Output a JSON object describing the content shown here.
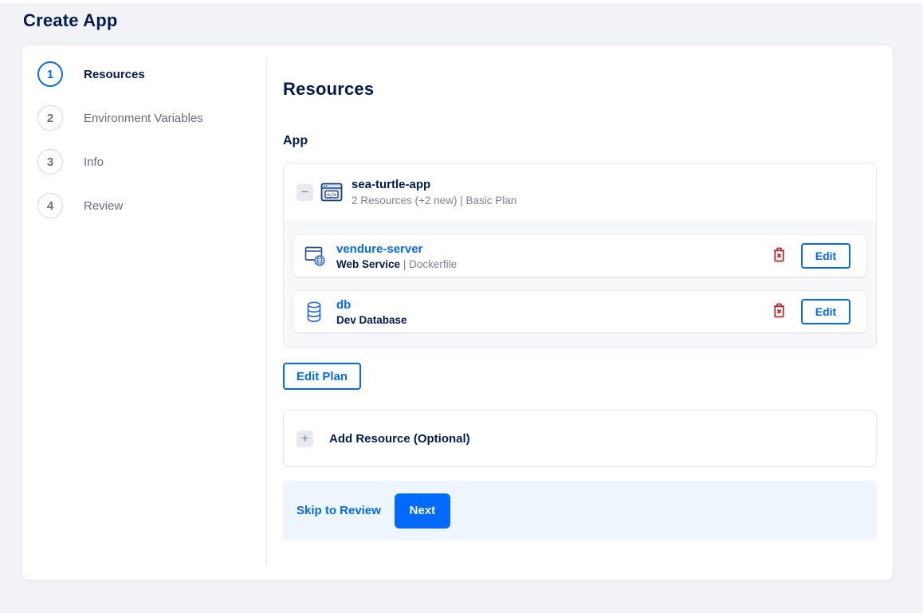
{
  "header": {
    "title": "Create App"
  },
  "stepper": {
    "active_step": 1,
    "steps": [
      {
        "number": "1",
        "label": "Resources"
      },
      {
        "number": "2",
        "label": "Environment Variables"
      },
      {
        "number": "3",
        "label": "Info"
      },
      {
        "number": "4",
        "label": "Review"
      }
    ]
  },
  "content": {
    "heading": "Resources",
    "app_section_label": "App",
    "app_group": {
      "collapse_glyph": "−",
      "name": "sea-turtle-app",
      "summary": "2 Resources (+2 new) | Basic Plan",
      "edit_button_label": "Edit",
      "resources": [
        {
          "name": "vendure-server",
          "type": "Web Service",
          "source": "| Dockerfile"
        },
        {
          "name": "db",
          "type": "Dev Database",
          "source": ""
        }
      ]
    },
    "edit_plan_label": "Edit Plan",
    "add_resource": {
      "expand_glyph": "+",
      "label": "Add Resource (Optional)"
    },
    "footer": {
      "skip_label": "Skip to Review",
      "next_label": "Next"
    }
  },
  "colors": {
    "accent_blue": "#0069ff",
    "heading_navy": "#031b4e",
    "muted_gray": "#7a8294",
    "danger_red": "#c21e1e",
    "footer_bg": "#eef5fc",
    "page_bg": "#f1f3f7"
  }
}
